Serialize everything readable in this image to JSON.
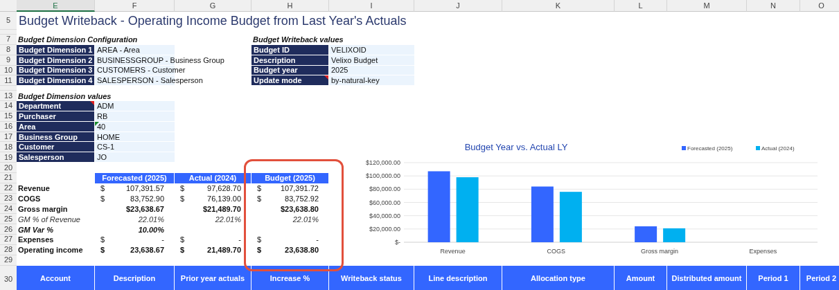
{
  "column_headers": [
    {
      "label": "E",
      "selected": true
    },
    {
      "label": "F",
      "selected": false
    },
    {
      "label": "G",
      "selected": false
    },
    {
      "label": "H",
      "selected": false
    },
    {
      "label": "I",
      "selected": false
    },
    {
      "label": "J",
      "selected": false
    },
    {
      "label": "K",
      "selected": false
    },
    {
      "label": "L",
      "selected": false
    },
    {
      "label": "M",
      "selected": false
    },
    {
      "label": "N",
      "selected": false
    },
    {
      "label": "O",
      "selected": false
    }
  ],
  "row_numbers": [
    "5",
    "7",
    "8",
    "9",
    "10",
    "11",
    "13",
    "14",
    "15",
    "16",
    "17",
    "18",
    "19",
    "20",
    "21",
    "22",
    "23",
    "24",
    "25",
    "26",
    "27",
    "28",
    "29",
    "30"
  ],
  "title": "Budget Writeback - Operating Income Budget from Last Year's Actuals",
  "config": {
    "heading": "Budget Dimension Configuration",
    "rows": [
      {
        "label": "Budget Dimension 1",
        "value": "AREA - Area",
        "label_note": false,
        "value_warning": false
      },
      {
        "label": "Budget Dimension 2",
        "value": "BUSINESSGROUP - Business Group",
        "label_note": false,
        "value_warning": false
      },
      {
        "label": "Budget Dimension 3",
        "value": "CUSTOMERS - Customer",
        "label_note": false,
        "value_warning": false
      },
      {
        "label": "Budget Dimension 4",
        "value": "SALESPERSON - Salesperson",
        "label_note": false,
        "value_warning": false
      }
    ]
  },
  "writeback": {
    "heading": "Budget Writeback values",
    "rows": [
      {
        "label": "Budget ID",
        "value": "VELIXOID",
        "label_note": false,
        "value_warning": false
      },
      {
        "label": "Description",
        "value": "Velixo Budget",
        "label_note": false,
        "value_warning": false
      },
      {
        "label": "Budget year",
        "value": "2025",
        "label_note": false,
        "value_warning": false
      },
      {
        "label": "Update mode",
        "value": "by-natural-key",
        "label_note": true,
        "value_warning": false
      }
    ]
  },
  "dimension_values": {
    "heading": "Budget Dimension values",
    "rows": [
      {
        "label": "Department",
        "value": "ADM",
        "label_note": true,
        "value_warning": false
      },
      {
        "label": "Purchaser",
        "value": "RB",
        "label_note": false,
        "value_warning": false
      },
      {
        "label": "Area",
        "value": "40",
        "label_note": false,
        "value_warning": true
      },
      {
        "label": "Business Group",
        "value": "HOME",
        "label_note": false,
        "value_warning": false
      },
      {
        "label": "Customer",
        "value": "CS-1",
        "label_note": false,
        "value_warning": false
      },
      {
        "label": "Salesperson",
        "value": "JO",
        "label_note": false,
        "value_warning": false
      }
    ]
  },
  "summary": {
    "columns": [
      "Forecasted (2025)",
      "Actual (2024)",
      "Budget (2025)"
    ],
    "rows": [
      {
        "label": "Revenue",
        "kind": "bold_label",
        "cells": [
          {
            "currency": "$",
            "amount": "107,391.57"
          },
          {
            "currency": "$",
            "amount": "97,628.70"
          },
          {
            "currency": "$",
            "amount": "107,391.72"
          }
        ]
      },
      {
        "label": "COGS",
        "kind": "bold_label",
        "cells": [
          {
            "currency": "$",
            "amount": "83,752.90"
          },
          {
            "currency": "$",
            "amount": "76,139.00"
          },
          {
            "currency": "$",
            "amount": "83,752.92"
          }
        ]
      },
      {
        "label": "Gross margin",
        "kind": "bold",
        "cells": [
          {
            "amount": "$23,638.67"
          },
          {
            "amount": "$21,489.70"
          },
          {
            "amount": "$23,638.80"
          }
        ]
      },
      {
        "label": "GM % of Revenue",
        "kind": "italic",
        "cells": [
          {
            "amount": "22.01%"
          },
          {
            "amount": "22.01%"
          },
          {
            "amount": "22.01%"
          }
        ]
      },
      {
        "label": "GM Var %",
        "kind": "bold_italic",
        "cells": [
          {
            "amount": "10.00%"
          }
        ]
      },
      {
        "label": "Expenses",
        "kind": "bold_label",
        "cells": [
          {
            "currency": "$",
            "amount": "-"
          },
          {
            "currency": "$",
            "amount": "-"
          },
          {
            "currency": "$",
            "amount": "-"
          }
        ]
      },
      {
        "label": "Operating income",
        "kind": "bold",
        "cells": [
          {
            "currency": "$",
            "amount": "23,638.67"
          },
          {
            "currency": "$",
            "amount": "21,489.70"
          },
          {
            "currency": "$",
            "amount": "23,638.80"
          }
        ]
      }
    ]
  },
  "chart_data": {
    "type": "bar",
    "title": "Budget Year vs. Actual LY",
    "categories": [
      "Revenue",
      "COGS",
      "Gross margin",
      "Expenses"
    ],
    "series": [
      {
        "name": "Forecasted (2025)",
        "color": "#3366ff",
        "values": [
          107000,
          84000,
          24000,
          0
        ]
      },
      {
        "name": "Actual (2024)",
        "color": "#00b0f0",
        "values": [
          98000,
          76000,
          21000,
          0
        ]
      }
    ],
    "ylim": [
      0,
      120000
    ],
    "grid": true,
    "legend": true,
    "yticks": [
      {
        "value": 0,
        "label": "$-"
      },
      {
        "value": 20000,
        "label": "$20,000.00"
      },
      {
        "value": 40000,
        "label": "$40,000.00"
      },
      {
        "value": 60000,
        "label": "$60,000.00"
      },
      {
        "value": 80000,
        "label": "$80,000.00"
      },
      {
        "value": 100000,
        "label": "$100,000.00"
      },
      {
        "value": 120000,
        "label": "$120,000.00"
      }
    ]
  },
  "table": {
    "columns": [
      "Account",
      "Description",
      "Prior year actuals",
      "Increase %",
      "Writeback status",
      "Line description",
      "Allocation type",
      "Amount",
      "Distributed amount",
      "Period 1",
      "Period 2"
    ]
  }
}
